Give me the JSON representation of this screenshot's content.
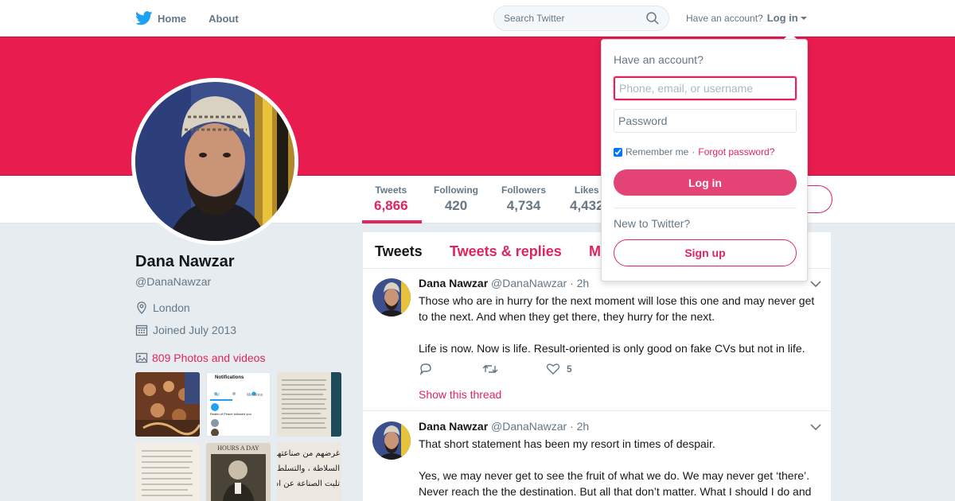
{
  "colors": {
    "accent": "#e0245e",
    "banner": "#e81c4f",
    "bird": "#1da1f2",
    "bg": "#e6ecf0"
  },
  "nav": {
    "home": "Home",
    "about": "About",
    "search_placeholder": "Search Twitter",
    "have_account": "Have an account?",
    "login": "Log in"
  },
  "stats": [
    {
      "label": "Tweets",
      "value": "6,866"
    },
    {
      "label": "Following",
      "value": "420"
    },
    {
      "label": "Followers",
      "value": "4,734"
    },
    {
      "label": "Likes",
      "value": "4,432"
    }
  ],
  "profile": {
    "name": "Dana Nawzar",
    "handle": "@DanaNawzar",
    "location": "London",
    "joined": "Joined July 2013",
    "photos": "809 Photos and videos"
  },
  "thumbs": {
    "notification_card": {
      "title": "Notifications",
      "tab_all": "All",
      "tab_mentions": "Mentions",
      "followed_text": "Realm of Peace followed you"
    },
    "book_title": "HOURS A DAY",
    "arabic_lines": [
      "غرضهم من صناعتهم الشر",
      "السلاطة ، والتسلط عل",
      "تلبت الصناعة عن است"
    ]
  },
  "tabs": {
    "tweets": "Tweets",
    "tweets_replies": "Tweets & replies",
    "media": "M"
  },
  "tweets": [
    {
      "name": "Dana Nawzar",
      "handle": "@DanaNawzar",
      "time": "· 2h",
      "para1": "Those who are in hurry for the next moment will lose this one and may never get to the next. And when they get there, they hurry for the next.",
      "para2": "Life is now. Now is life. Result-oriented is only good on fake CVs but not in life.",
      "likes": "5",
      "show_thread": "Show this thread"
    },
    {
      "name": "Dana Nawzar",
      "handle": "@DanaNawzar",
      "time": "· 2h",
      "para1": "That short statement has been my resort in times of despair.",
      "para2": "Yes, we may never get to see the fruit of what we do. We may never get ‘there’. Never reach the the destination. But all that don’t matter. What I should I do and"
    }
  ],
  "login_dropdown": {
    "title": "Have an account?",
    "username_placeholder": "Phone, email, or username",
    "password_placeholder": "Password",
    "remember": "Remember me",
    "dot": "·",
    "forgot": "Forgot password?",
    "login_button": "Log in",
    "new_to_twitter": "New to Twitter?",
    "signup_button": "Sign up"
  }
}
